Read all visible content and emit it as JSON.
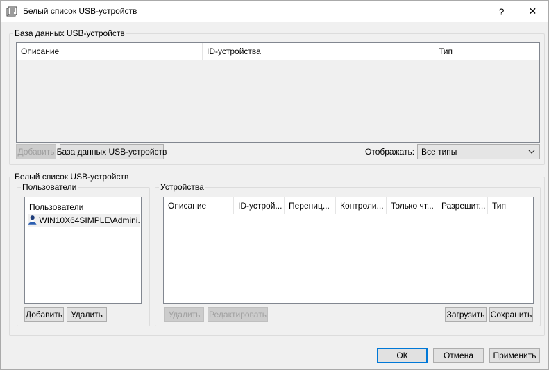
{
  "window": {
    "title": "Белый список USB-устройств",
    "help_label": "?",
    "close_label": "✕"
  },
  "db_section": {
    "title": "База данных USB-устройств",
    "columns": [
      "Описание",
      "ID-устройства",
      "Тип"
    ],
    "add_label": "Добавить",
    "db_button_label": "База данных USB-устройств",
    "show_label": "Отображать:",
    "filter_value": "Все типы"
  },
  "whitelist_section": {
    "title": "Белый список USB-устройств",
    "users": {
      "title": "Пользователи",
      "header": "Пользователи",
      "items": [
        "WIN10X64SIMPLE\\Admini..."
      ],
      "add_label": "Добавить",
      "delete_label": "Удалить"
    },
    "devices": {
      "title": "Устройства",
      "columns": [
        "Описание",
        "ID-устрой...",
        "Перениц...",
        "Контроли...",
        "Только чт...",
        "Разрешит...",
        "Тип"
      ],
      "delete_label": "Удалить",
      "edit_label": "Редактировать",
      "load_label": "Загрузить",
      "save_label": "Сохранить"
    }
  },
  "footer": {
    "ok_label": "ОК",
    "cancel_label": "Отмена",
    "apply_label": "Применить"
  },
  "colors": {
    "accent": "#0078d7",
    "disabled_text": "#a0a0a0"
  }
}
